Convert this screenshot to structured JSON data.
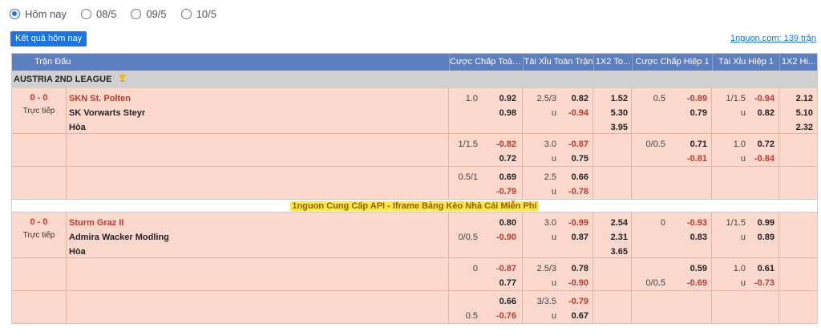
{
  "date_filter": {
    "options": [
      {
        "label": "Hôm nay",
        "checked": true
      },
      {
        "label": "08/5",
        "checked": false
      },
      {
        "label": "09/5",
        "checked": false
      },
      {
        "label": "10/5",
        "checked": false
      }
    ]
  },
  "toolbar": {
    "today_results_label": "Kết quả hôm nay",
    "match_count_link": "1nguon.com: 139 trận"
  },
  "table": {
    "headers": [
      "Trận Đấu",
      "Cược Chấp Toàn...",
      "Tài Xỉu Toàn Trận",
      "1X2 To...",
      "Cược Chấp Hiệp 1",
      "Tài Xỉu Hiệp 1",
      "1X2 Hi..."
    ]
  },
  "league": {
    "name": "AUSTRIA 2ND LEAGUE",
    "icon": "trophy-icon",
    "icon_color": "#e8b923"
  },
  "promo": {
    "text": "1nguon Cung Cấp API - Iframe Bảng Kèo Nhà Cái Miễn Phí"
  },
  "colors": {
    "header": "#5b7fc0",
    "row": "#fcd8cd",
    "negative": "#c0392b",
    "button": "#1a73e8"
  },
  "matches": [
    {
      "score": "0 - 0",
      "status": "Trực tiếp",
      "home": "SKN St. Polten",
      "away": "SK Vorwarts Steyr",
      "draw": "Hòa",
      "rows": [
        {
          "hcp": [
            [
              "1.0",
              "0.92"
            ],
            [
              "",
              "0.98"
            ],
            [
              "",
              ""
            ]
          ],
          "ou": [
            [
              "2.5/3",
              "0.82"
            ],
            [
              "u",
              "-0.94"
            ],
            [
              "",
              ""
            ]
          ],
          "x12": [
            "1.52",
            "5.30",
            "3.95"
          ],
          "hcp1": [
            [
              "0.5",
              "-0.89"
            ],
            [
              "",
              "0.79"
            ],
            [
              "",
              ""
            ]
          ],
          "ou1": [
            [
              "1/1.5",
              "-0.94"
            ],
            [
              "u",
              "0.82"
            ],
            [
              "",
              ""
            ]
          ],
          "x12h": [
            "2.12",
            "5.10",
            "2.32"
          ]
        },
        {
          "hcp": [
            [
              "1/1.5",
              "-0.82"
            ],
            [
              "",
              "0.72"
            ]
          ],
          "ou": [
            [
              "3.0",
              "-0.87"
            ],
            [
              "u",
              "0.75"
            ]
          ],
          "x12": [
            "",
            ""
          ],
          "hcp1": [
            [
              "0/0.5",
              "0.71"
            ],
            [
              "",
              "-0.81"
            ]
          ],
          "ou1": [
            [
              "1.0",
              "0.72"
            ],
            [
              "u",
              "-0.84"
            ]
          ],
          "x12h": [
            "",
            ""
          ]
        },
        {
          "hcp": [
            [
              "0.5/1",
              "0.69"
            ],
            [
              "",
              "-0.79"
            ]
          ],
          "ou": [
            [
              "2.5",
              "0.66"
            ],
            [
              "u",
              "-0.78"
            ]
          ],
          "x12": [
            "",
            ""
          ],
          "hcp1": [
            [
              "",
              ""
            ],
            [
              "",
              ""
            ]
          ],
          "ou1": [
            [
              "",
              ""
            ],
            [
              "",
              ""
            ]
          ],
          "x12h": [
            "",
            ""
          ]
        }
      ]
    },
    {
      "score": "0 - 0",
      "status": "Trực tiếp",
      "home": "Sturm Graz II",
      "away": "Admira Wacker Modling",
      "draw": "Hòa",
      "rows": [
        {
          "hcp": [
            [
              "",
              "0.80"
            ],
            [
              "0/0.5",
              "-0.90"
            ],
            [
              "",
              ""
            ]
          ],
          "ou": [
            [
              "3.0",
              "-0.99"
            ],
            [
              "u",
              "0.87"
            ],
            [
              "",
              ""
            ]
          ],
          "x12": [
            "2.54",
            "2.31",
            "3.65"
          ],
          "hcp1": [
            [
              "0",
              "-0.93"
            ],
            [
              "",
              "0.83"
            ],
            [
              "",
              ""
            ]
          ],
          "ou1": [
            [
              "1/1.5",
              "0.99"
            ],
            [
              "u",
              "0.89"
            ],
            [
              "",
              ""
            ]
          ],
          "x12h": [
            "",
            "",
            ""
          ]
        },
        {
          "hcp": [
            [
              "0",
              "-0.87"
            ],
            [
              "",
              "0.77"
            ]
          ],
          "ou": [
            [
              "2.5/3",
              "0.78"
            ],
            [
              "u",
              "-0.90"
            ]
          ],
          "x12": [
            "",
            ""
          ],
          "hcp1": [
            [
              "",
              "0.59"
            ],
            [
              "0/0.5",
              "-0.69"
            ]
          ],
          "ou1": [
            [
              "1.0",
              "0.61"
            ],
            [
              "u",
              "-0.73"
            ]
          ],
          "x12h": [
            "",
            ""
          ]
        },
        {
          "hcp": [
            [
              "",
              "0.66"
            ],
            [
              "0.5",
              "-0.76"
            ]
          ],
          "ou": [
            [
              "3/3.5",
              "-0.79"
            ],
            [
              "u",
              "0.67"
            ]
          ],
          "x12": [
            "",
            ""
          ],
          "hcp1": [
            [
              "",
              ""
            ],
            [
              "",
              ""
            ]
          ],
          "ou1": [
            [
              "",
              ""
            ],
            [
              "",
              ""
            ]
          ],
          "x12h": [
            "",
            ""
          ]
        }
      ]
    }
  ]
}
